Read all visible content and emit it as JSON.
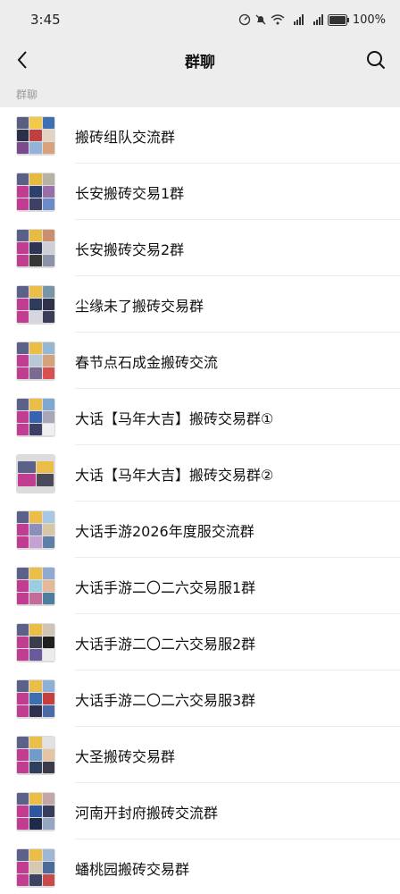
{
  "status_bar": {
    "time": "3:45",
    "battery": "100%"
  },
  "nav": {
    "title": "群聊"
  },
  "section": {
    "label": "群聊"
  },
  "groups": [
    {
      "name": "搬砖组队交流群",
      "avatar": [
        "#5a5f80",
        "#f3c94a",
        "#3d6fb2",
        "#2a3048",
        "#c04040",
        "#e3d3c0",
        "#7a4b8c",
        "#92b4d8",
        "#d9a27a"
      ]
    },
    {
      "name": "长安搬砖交易1群",
      "avatar": [
        "#5a6088",
        "#e6b93f",
        "#b8b1a6",
        "#c23c92",
        "#2c3f6e",
        "#9a6ea9",
        "#c23c92",
        "#3d3f64",
        "#6b8cc8"
      ]
    },
    {
      "name": "长安搬砖交易2群",
      "avatar": [
        "#59608a",
        "#e9bb42",
        "#c98f6e",
        "#c23c92",
        "#2e3556",
        "#cfcfd6",
        "#c23c92",
        "#373737",
        "#8a93a8"
      ]
    },
    {
      "name": "尘缘未了搬砖交易群",
      "avatar": [
        "#5b6189",
        "#ecbe47",
        "#7894a7",
        "#c23c92",
        "#2d3c5c",
        "#30304a",
        "#c23c92",
        "#d6d6e0",
        "#3a3d5a"
      ]
    },
    {
      "name": "春节点石成金搬砖交流",
      "avatar": [
        "#5b6189",
        "#ecbe47",
        "#96b7d3",
        "#c23c92",
        "#b9c8d6",
        "#d4a27c",
        "#c23c92",
        "#7c6a93",
        "#d85050"
      ]
    },
    {
      "name": "大话【马年大吉】搬砖交易群①",
      "avatar": [
        "#5b6189",
        "#ecbe47",
        "#7ea7d2",
        "#c23c92",
        "#3662b0",
        "#a7a7b7",
        "#c23c92",
        "#3d3f64",
        "#f0f0f0"
      ]
    },
    {
      "name": "大话【马年大吉】搬砖交易群②",
      "avatar": [
        "#5b6189",
        "#ecbe47",
        "#c23c92",
        "#4a4a5a"
      ]
    },
    {
      "name": "大话手游2026年度服交流群",
      "avatar": [
        "#5b6189",
        "#ecbe47",
        "#a7c7e3",
        "#c23c92",
        "#8c8fbb",
        "#d8c7a7",
        "#c23c92",
        "#c5a2d1",
        "#5f7fa8"
      ]
    },
    {
      "name": "大话手游二〇二六交易服1群",
      "avatar": [
        "#5b6189",
        "#ecbe47",
        "#8fa9d0",
        "#c23c92",
        "#9acde0",
        "#e5b89a",
        "#c23c92",
        "#c36b9b",
        "#4e7e9e"
      ]
    },
    {
      "name": "大话手游二〇二六交易服2群",
      "avatar": [
        "#5b6189",
        "#ecbe47",
        "#d0c4b4",
        "#c23c92",
        "#3b3d4a",
        "#202020",
        "#c23c92",
        "#6b5a9b",
        "#ececec"
      ]
    },
    {
      "name": "大话手游二〇二六交易服3群",
      "avatar": [
        "#5b6189",
        "#ecbe47",
        "#8db0d8",
        "#c23c92",
        "#3c6fb1",
        "#c63e3e",
        "#c23c92",
        "#2d2f4d",
        "#4a6aa8"
      ]
    },
    {
      "name": "大圣搬砖交易群",
      "avatar": [
        "#5b6189",
        "#ecbe47",
        "#e2e2e2",
        "#c23c92",
        "#6f9cc8",
        "#e7c3a6",
        "#c23c92",
        "#2f3f5c",
        "#3a3a4a"
      ]
    },
    {
      "name": "河南开封府搬砖交流群",
      "avatar": [
        "#5b6189",
        "#ecbe47",
        "#c3a7a7",
        "#c23c92",
        "#2f56a0",
        "#3a3d5a",
        "#c23c92",
        "#1e2a4a",
        "#94a6c2"
      ]
    },
    {
      "name": "蟠桃园搬砖交易群",
      "avatar": [
        "#5b6189",
        "#ecbe47",
        "#9fb7d4",
        "#c23c92",
        "#d7c8b2",
        "#4d6b9a",
        "#c23c92",
        "#3b4262",
        "#c84a4a"
      ]
    }
  ]
}
